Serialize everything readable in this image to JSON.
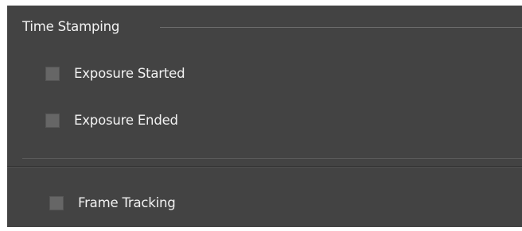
{
  "time_stamping": {
    "title": "Time Stamping",
    "options": [
      {
        "label": "Exposure Started",
        "checked": false
      },
      {
        "label": "Exposure Ended",
        "checked": false
      }
    ]
  },
  "frame_tracking": {
    "label": "Frame Tracking",
    "checked": false
  },
  "colors": {
    "panel_background": "#434343",
    "text": "#f2f2f2",
    "checkbox_fill": "#666666",
    "divider": "#6d6d6d"
  }
}
